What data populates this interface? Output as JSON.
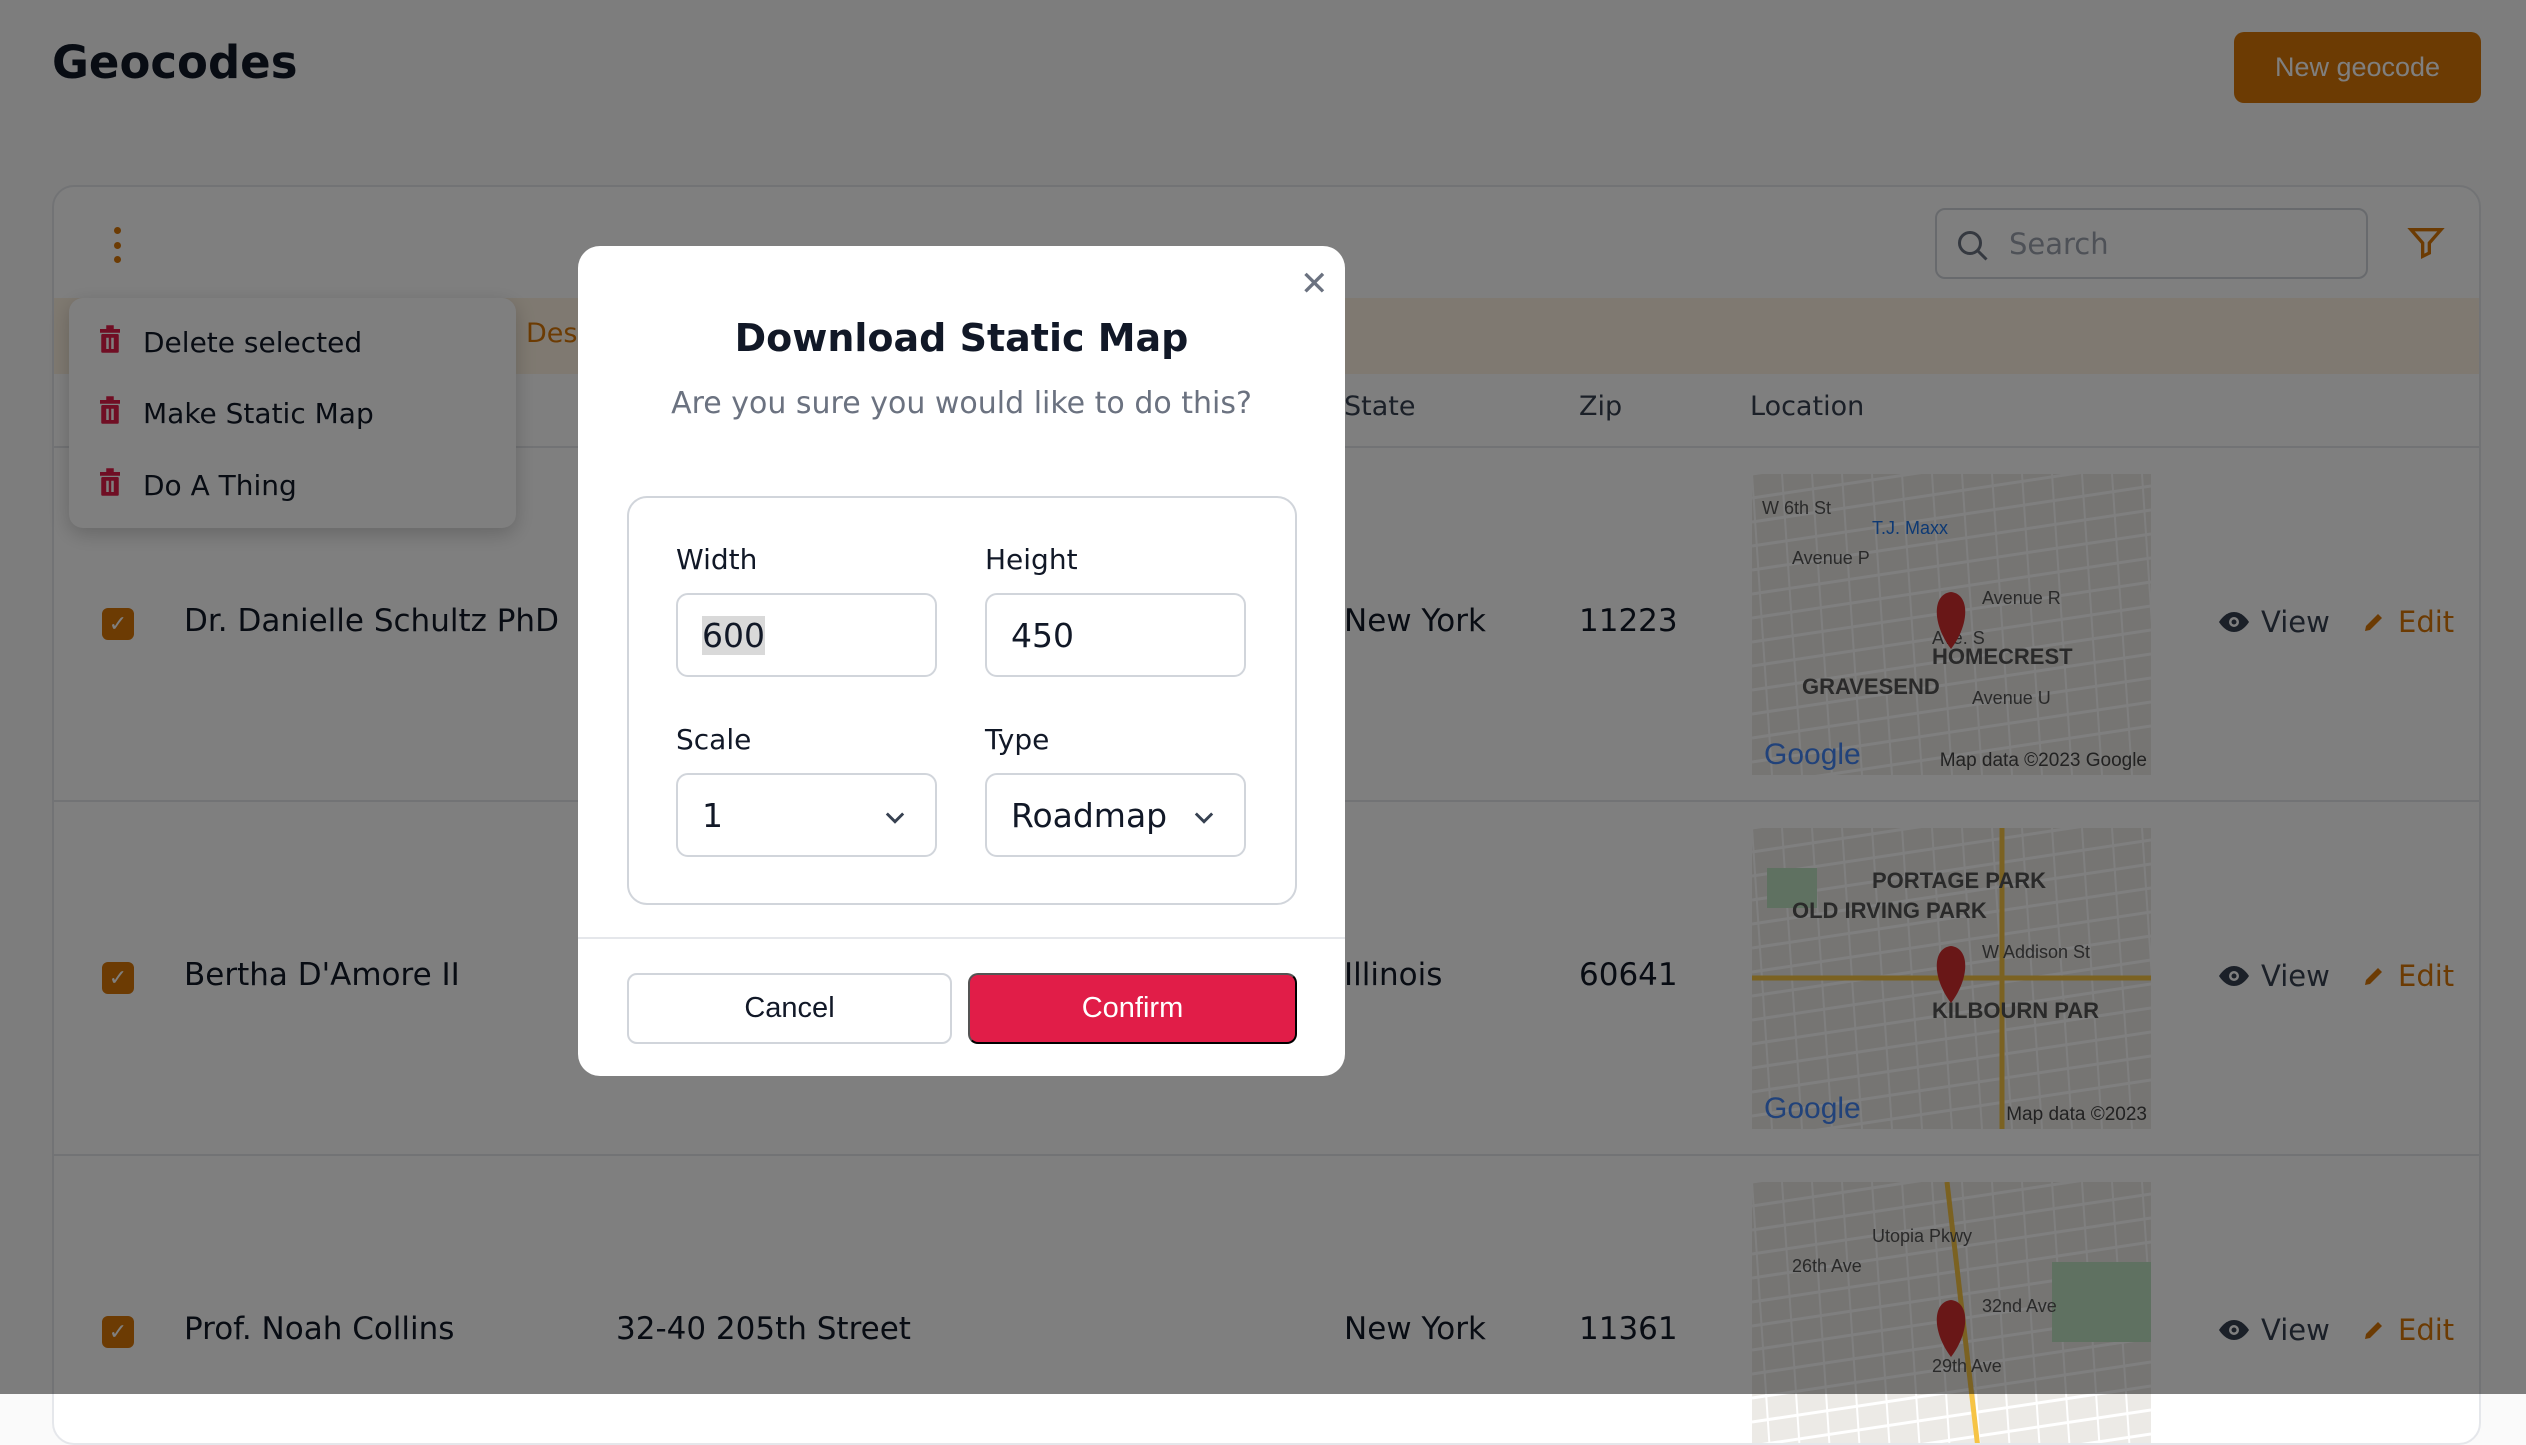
{
  "page": {
    "title": "Geocodes",
    "new_button": "New geocode"
  },
  "toolbar": {
    "search_placeholder": "Search"
  },
  "bulk_bar": {
    "partial_text": "Des"
  },
  "menu": {
    "items": [
      {
        "label": "Delete selected",
        "icon": "trash-icon"
      },
      {
        "label": "Make Static Map",
        "icon": "trash-icon"
      },
      {
        "label": "Do A Thing",
        "icon": "trash-icon"
      }
    ]
  },
  "table": {
    "headers": {
      "state": "State",
      "zip": "Zip",
      "location": "Location"
    },
    "rows": [
      {
        "checked": true,
        "name": "Dr. Danielle Schultz PhD",
        "address": "",
        "state": "New York",
        "zip": "11223",
        "map": {
          "labels": [
            "T.J. Maxx",
            "Avenue P",
            "Avenue R",
            "HOMECREST",
            "GRAVESEND",
            "Avenue U",
            "Ave. S",
            "W 6th St"
          ],
          "attribution": "Map data ©2023 Google",
          "logo": "Google"
        }
      },
      {
        "checked": true,
        "name": "Bertha D'Amore II",
        "address": "",
        "state": "Illinois",
        "zip": "60641",
        "map": {
          "labels": [
            "PORTAGE PARK",
            "OLD IRVING PARK",
            "W Addison St",
            "KILBOURN PAR"
          ],
          "attribution": "Map data ©2023",
          "logo": "Google"
        }
      },
      {
        "checked": true,
        "name": "Prof. Noah Collins",
        "address": "32-40 205th Street",
        "state": "New York",
        "zip": "11361",
        "map": {
          "labels": [
            "Utopia Pkwy",
            "26th Ave",
            "32nd Ave",
            "29th Ave"
          ],
          "attribution": "",
          "logo": ""
        }
      }
    ],
    "view_label": "View",
    "edit_label": "Edit"
  },
  "modal": {
    "title": "Download Static Map",
    "subtitle": "Are you sure you would like to do this?",
    "width_label": "Width",
    "width_value": "600",
    "height_label": "Height",
    "height_value": "450",
    "scale_label": "Scale",
    "scale_value": "1",
    "type_label": "Type",
    "type_value": "Roadmap",
    "cancel": "Cancel",
    "confirm": "Confirm"
  },
  "colors": {
    "accent": "#d97706",
    "danger": "#e11d48"
  }
}
